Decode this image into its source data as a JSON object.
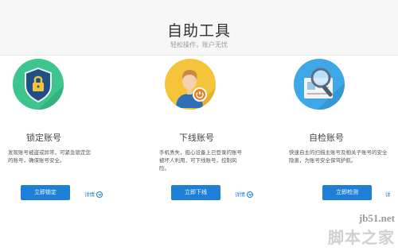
{
  "header": {
    "title": "自助工具",
    "subtitle": "轻松操作，账户无忧"
  },
  "cards": [
    {
      "title": "锁定账号",
      "desc": "发现账号被盗或异常，可紧急锁定您的账号，确保账号安全。",
      "button": "立即锁定",
      "detail": "详情",
      "icon": "lock-shield-icon",
      "color": "#3ec48e"
    },
    {
      "title": "下线账号",
      "desc": "手机丢失，担心设备上已登录的账号被坏人利用，可下线账号，控制风险。",
      "button": "立即下线",
      "detail": "详情",
      "icon": "user-logout-icon",
      "color": "#f5c43a"
    },
    {
      "title": "自检账号",
      "desc": "快速自主的扫描主账号及相关子账号的安全隐患，为账号安全保驾护航。",
      "button": "立即检测",
      "detail": "详",
      "icon": "magnifier-check-icon",
      "color": "#3ea8e6"
    }
  ],
  "watermark": {
    "url": "jb51.net",
    "name": "脚本之家"
  }
}
